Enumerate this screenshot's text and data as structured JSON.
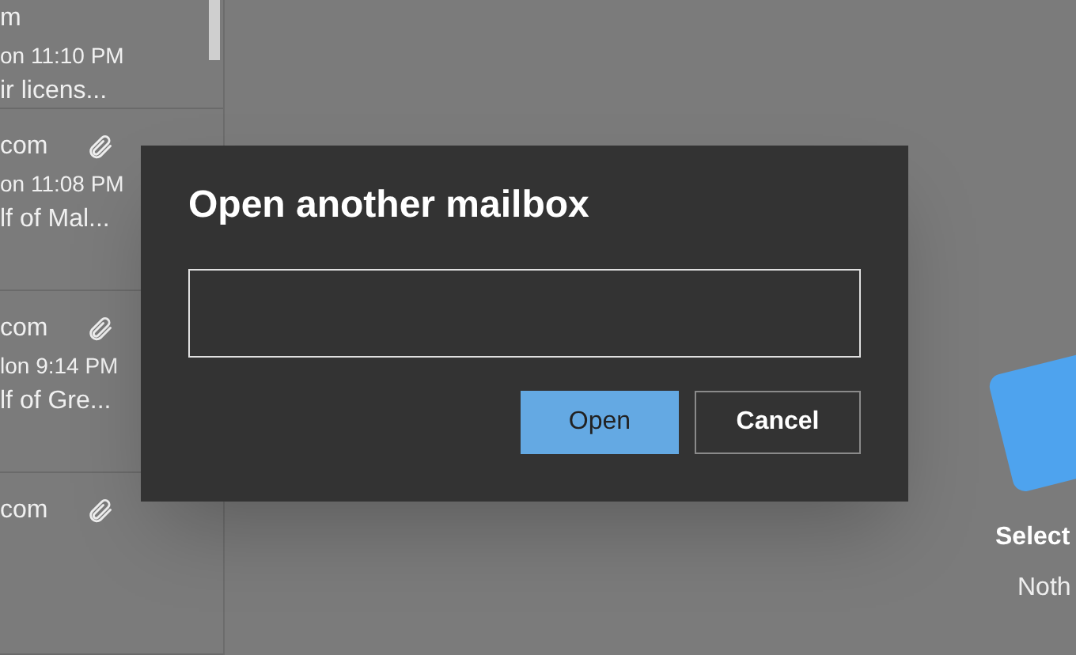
{
  "messages": [
    {
      "sender": "m",
      "date": "on 11:10 PM",
      "preview": "ir licens...",
      "attachment": false
    },
    {
      "sender": "com",
      "date": "on 11:08 PM",
      "preview": "lf of Mal...",
      "attachment": true
    },
    {
      "sender": "com",
      "date": "lon 9:14 PM",
      "preview": "lf of Gre...",
      "attachment": true
    },
    {
      "sender": "com",
      "attachment": true
    }
  ],
  "empty_state": {
    "title": "Select",
    "subtitle": "Noth"
  },
  "dialog": {
    "title": "Open another mailbox",
    "buttons": [
      {
        "label": "Open",
        "kind": "primary"
      },
      {
        "label": "Cancel",
        "kind": "secondary"
      }
    ]
  }
}
